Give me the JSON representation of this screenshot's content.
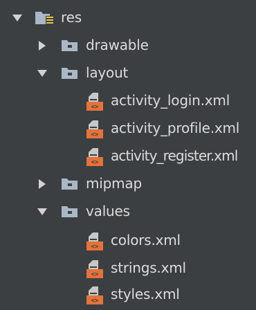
{
  "tree": {
    "root": {
      "label": "res",
      "expanded": true,
      "icon": "resource-folder-icon"
    },
    "items": [
      {
        "label": "drawable",
        "expanded": false,
        "icon": "folder-icon"
      },
      {
        "label": "layout",
        "expanded": true,
        "icon": "folder-icon",
        "children": [
          {
            "label": "activity_login.xml",
            "icon": "xml-file-icon"
          },
          {
            "label": "activity_profile.xml",
            "icon": "xml-file-icon"
          },
          {
            "label": "activity_register.xml",
            "icon": "xml-file-icon"
          }
        ]
      },
      {
        "label": "mipmap",
        "expanded": false,
        "icon": "folder-icon"
      },
      {
        "label": "values",
        "expanded": true,
        "icon": "folder-icon",
        "children": [
          {
            "label": "colors.xml",
            "icon": "xml-file-icon"
          },
          {
            "label": "strings.xml",
            "icon": "xml-file-icon"
          },
          {
            "label": "styles.xml",
            "icon": "xml-file-icon"
          }
        ]
      }
    ]
  },
  "colors": {
    "background": "#3c3f41",
    "text": "#dcdcdc",
    "arrow": "#d2d2d2",
    "folder": "#a9b7c6",
    "xml_orange": "#e2733a"
  }
}
